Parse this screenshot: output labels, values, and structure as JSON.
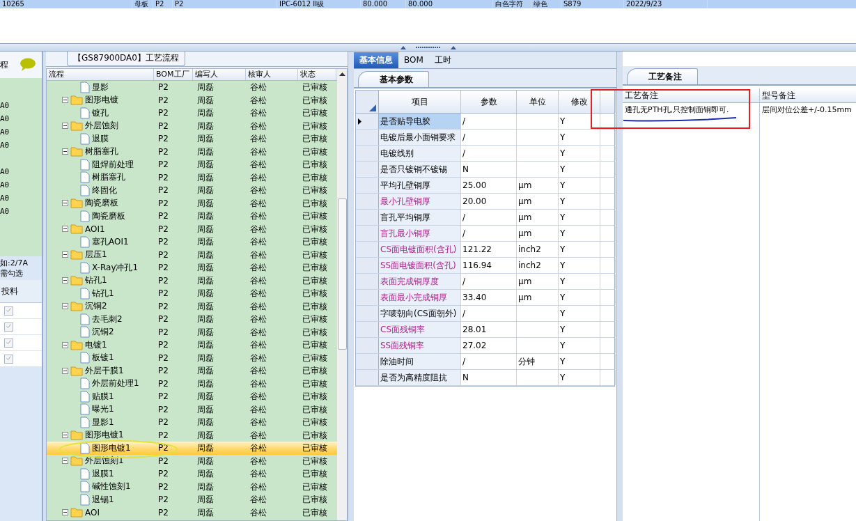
{
  "top_grid": {
    "row": {
      "selected": true,
      "cells": [
        "10265",
        "母板",
        "P2",
        "P2",
        "IPC-6012 II级",
        "80.000",
        "80.000",
        "白色字符",
        "绿色",
        "S879",
        "2022/9/23"
      ]
    }
  },
  "left_strip": {
    "header_text": "程",
    "codes": [
      "A0",
      "A0",
      "A0",
      "A0",
      "A0",
      "A0",
      "A0",
      "A0"
    ],
    "hint_lines": [
      "如:2/7A",
      "需勾选"
    ],
    "column": "投料",
    "checks": [
      {
        "checked": true
      },
      {
        "checked": true
      },
      {
        "checked": true
      },
      {
        "checked": true
      }
    ]
  },
  "process_panel": {
    "title": "【GS87900DA0】工艺流程",
    "columns": [
      "流程",
      "BOM工厂",
      "编写人",
      "核审人",
      "状态"
    ],
    "rows": [
      {
        "kind": "file",
        "label": "显影",
        "factory": "P2",
        "writer": "周磊",
        "reviewer": "谷松",
        "status": "已审核",
        "selected": false
      },
      {
        "kind": "folder",
        "label": "图形电镀",
        "factory": "P2",
        "writer": "周磊",
        "reviewer": "谷松",
        "status": "已审核",
        "selected": false,
        "expanded": true,
        "children": [
          {
            "kind": "file",
            "label": "镀孔",
            "factory": "P2",
            "writer": "周磊",
            "reviewer": "谷松",
            "status": "已审核",
            "selected": false
          }
        ]
      },
      {
        "kind": "folder",
        "label": "外层蚀刻",
        "factory": "P2",
        "writer": "周磊",
        "reviewer": "谷松",
        "status": "已审核",
        "selected": false,
        "expanded": true,
        "children": [
          {
            "kind": "file",
            "label": "退膜",
            "factory": "P2",
            "writer": "周磊",
            "reviewer": "谷松",
            "status": "已审核",
            "selected": false
          }
        ]
      },
      {
        "kind": "folder",
        "label": "树脂塞孔",
        "factory": "P2",
        "writer": "周磊",
        "reviewer": "谷松",
        "status": "已审核",
        "selected": false,
        "expanded": true,
        "children": [
          {
            "kind": "file",
            "label": "阻焊前处理",
            "factory": "P2",
            "writer": "周磊",
            "reviewer": "谷松",
            "status": "已审核",
            "selected": false
          },
          {
            "kind": "file",
            "label": "树脂塞孔",
            "factory": "P2",
            "writer": "周磊",
            "reviewer": "谷松",
            "status": "已审核",
            "selected": false
          },
          {
            "kind": "file",
            "label": "终固化",
            "factory": "P2",
            "writer": "周磊",
            "reviewer": "谷松",
            "status": "已审核",
            "selected": false
          }
        ]
      },
      {
        "kind": "folder",
        "label": "陶瓷磨板",
        "factory": "P2",
        "writer": "周磊",
        "reviewer": "谷松",
        "status": "已审核",
        "selected": false,
        "expanded": true,
        "children": [
          {
            "kind": "file",
            "label": "陶瓷磨板",
            "factory": "P2",
            "writer": "周磊",
            "reviewer": "谷松",
            "status": "已审核",
            "selected": false
          }
        ]
      },
      {
        "kind": "folder",
        "label": "AOI1",
        "factory": "P2",
        "writer": "周磊",
        "reviewer": "谷松",
        "status": "已审核",
        "selected": false,
        "expanded": true,
        "children": [
          {
            "kind": "file",
            "label": "塞孔AOI1",
            "factory": "P2",
            "writer": "周磊",
            "reviewer": "谷松",
            "status": "已审核",
            "selected": false
          }
        ]
      },
      {
        "kind": "folder",
        "label": "层压1",
        "factory": "P2",
        "writer": "周磊",
        "reviewer": "谷松",
        "status": "已审核",
        "selected": false,
        "expanded": true,
        "children": [
          {
            "kind": "file",
            "label": "X-Ray冲孔1",
            "factory": "P2",
            "writer": "周磊",
            "reviewer": "谷松",
            "status": "已审核",
            "selected": false
          }
        ]
      },
      {
        "kind": "folder",
        "label": "钻孔1",
        "factory": "P2",
        "writer": "周磊",
        "reviewer": "谷松",
        "status": "已审核",
        "selected": false,
        "expanded": true,
        "children": [
          {
            "kind": "file",
            "label": "钻孔1",
            "factory": "P2",
            "writer": "周磊",
            "reviewer": "谷松",
            "status": "已审核",
            "selected": false
          }
        ]
      },
      {
        "kind": "folder",
        "label": "沉铜2",
        "factory": "P2",
        "writer": "周磊",
        "reviewer": "谷松",
        "status": "已审核",
        "selected": false,
        "expanded": true,
        "children": [
          {
            "kind": "file",
            "label": "去毛刺2",
            "factory": "P2",
            "writer": "周磊",
            "reviewer": "谷松",
            "status": "已审核",
            "selected": false
          },
          {
            "kind": "file",
            "label": "沉铜2",
            "factory": "P2",
            "writer": "周磊",
            "reviewer": "谷松",
            "status": "已审核",
            "selected": false
          }
        ]
      },
      {
        "kind": "folder",
        "label": "电镀1",
        "factory": "P2",
        "writer": "周磊",
        "reviewer": "谷松",
        "status": "已审核",
        "selected": false,
        "expanded": true,
        "children": [
          {
            "kind": "file",
            "label": "板镀1",
            "factory": "P2",
            "writer": "周磊",
            "reviewer": "谷松",
            "status": "已审核",
            "selected": false
          }
        ]
      },
      {
        "kind": "folder",
        "label": "外层干膜1",
        "factory": "P2",
        "writer": "周磊",
        "reviewer": "谷松",
        "status": "已审核",
        "selected": false,
        "expanded": true,
        "children": [
          {
            "kind": "file",
            "label": "外层前处理1",
            "factory": "P2",
            "writer": "周磊",
            "reviewer": "谷松",
            "status": "已审核",
            "selected": false
          },
          {
            "kind": "file",
            "label": "贴膜1",
            "factory": "P2",
            "writer": "周磊",
            "reviewer": "谷松",
            "status": "已审核",
            "selected": false
          },
          {
            "kind": "file",
            "label": "曝光1",
            "factory": "P2",
            "writer": "周磊",
            "reviewer": "谷松",
            "status": "已审核",
            "selected": false
          },
          {
            "kind": "file",
            "label": "显影1",
            "factory": "P2",
            "writer": "周磊",
            "reviewer": "谷松",
            "status": "已审核",
            "selected": false
          }
        ]
      },
      {
        "kind": "folder",
        "label": "图形电镀1",
        "factory": "P2",
        "writer": "周磊",
        "reviewer": "谷松",
        "status": "已审核",
        "selected": false,
        "expanded": true,
        "children": [
          {
            "kind": "file",
            "label": "图形电镀1",
            "factory": "P2",
            "writer": "周磊",
            "reviewer": "谷松",
            "status": "已审核",
            "selected": true
          }
        ]
      },
      {
        "kind": "folder",
        "label": "外层蚀刻1",
        "factory": "P2",
        "writer": "周磊",
        "reviewer": "谷松",
        "status": "已审核",
        "selected": false,
        "expanded": true,
        "children": [
          {
            "kind": "file",
            "label": "退膜1",
            "factory": "P2",
            "writer": "周磊",
            "reviewer": "谷松",
            "status": "已审核",
            "selected": false
          },
          {
            "kind": "file",
            "label": "碱性蚀刻1",
            "factory": "P2",
            "writer": "周磊",
            "reviewer": "谷松",
            "status": "已审核",
            "selected": false
          },
          {
            "kind": "file",
            "label": "退锡1",
            "factory": "P2",
            "writer": "周磊",
            "reviewer": "谷松",
            "status": "已审核",
            "selected": false
          }
        ]
      },
      {
        "kind": "folder",
        "label": "AOI",
        "factory": "P2",
        "writer": "周磊",
        "reviewer": "谷松",
        "status": "已审核",
        "selected": false,
        "expanded": true
      }
    ]
  },
  "detail_panel": {
    "tabs": [
      {
        "label": "基本信息",
        "selected": true
      },
      {
        "label": "BOM",
        "selected": false
      },
      {
        "label": "工时",
        "selected": false
      }
    ],
    "sub_tab": "基本参数",
    "columns": [
      "项目",
      "参数",
      "单位",
      "修改"
    ],
    "rows": [
      {
        "item": "是否贴导电胶",
        "param": "/",
        "modify": "Y",
        "flagged": false,
        "selected": true
      },
      {
        "item": "电镀后最小面铜要求",
        "param": "/",
        "modify": "Y",
        "flagged": false,
        "selected": false
      },
      {
        "item": "电镀线别",
        "param": "/",
        "modify": "Y",
        "flagged": false,
        "selected": false
      },
      {
        "item": "是否只镀铜不镀锡",
        "param": "N",
        "modify": "Y",
        "flagged": false,
        "selected": false
      },
      {
        "item": "平均孔壁铜厚",
        "param": "25.00",
        "unit": "μm",
        "modify": "Y",
        "flagged": false,
        "selected": false
      },
      {
        "item": "最小孔壁铜厚",
        "param": "20.00",
        "unit": "μm",
        "modify": "Y",
        "flagged": true,
        "selected": false
      },
      {
        "item": "盲孔平均铜厚",
        "param": "/",
        "unit": "μm",
        "modify": "Y",
        "flagged": false,
        "selected": false
      },
      {
        "item": "盲孔最小铜厚",
        "param": "/",
        "unit": "μm",
        "modify": "Y",
        "flagged": true,
        "selected": false
      },
      {
        "item": "CS面电镀面积(含孔)",
        "param": "121.22",
        "unit": "inch2",
        "modify": "Y",
        "flagged": true,
        "selected": false
      },
      {
        "item": "SS面电镀面积(含孔)",
        "param": "116.94",
        "unit": "inch2",
        "modify": "Y",
        "flagged": true,
        "selected": false
      },
      {
        "item": "表面完成铜厚度",
        "param": "/",
        "unit": "μm",
        "modify": "Y",
        "flagged": true,
        "selected": false
      },
      {
        "item": "表面最小完成铜厚",
        "param": "33.40",
        "unit": "μm",
        "modify": "Y",
        "flagged": true,
        "selected": false
      },
      {
        "item": "字唛朝向(CS面朝外)",
        "param": "/",
        "modify": "Y",
        "flagged": false,
        "selected": false
      },
      {
        "item": "CS面残铜率",
        "param": "28.01",
        "modify": "Y",
        "flagged": true,
        "selected": false
      },
      {
        "item": "SS面残铜率",
        "param": "27.02",
        "modify": "Y",
        "flagged": true,
        "selected": false
      },
      {
        "item": "除油时间",
        "param": "/",
        "unit": "分钟",
        "modify": "Y",
        "flagged": false,
        "selected": false
      },
      {
        "item": "是否为高精度阻抗",
        "param": "N",
        "modify": "Y",
        "flagged": false,
        "selected": false
      }
    ]
  },
  "notes_panel": {
    "tab": "工艺备注",
    "columns": [
      "工艺备注",
      "型号备注"
    ],
    "row": [
      "通孔无PTH孔,只控制面铜即可.",
      "层间对位公差+/-0.15mm"
    ]
  }
}
